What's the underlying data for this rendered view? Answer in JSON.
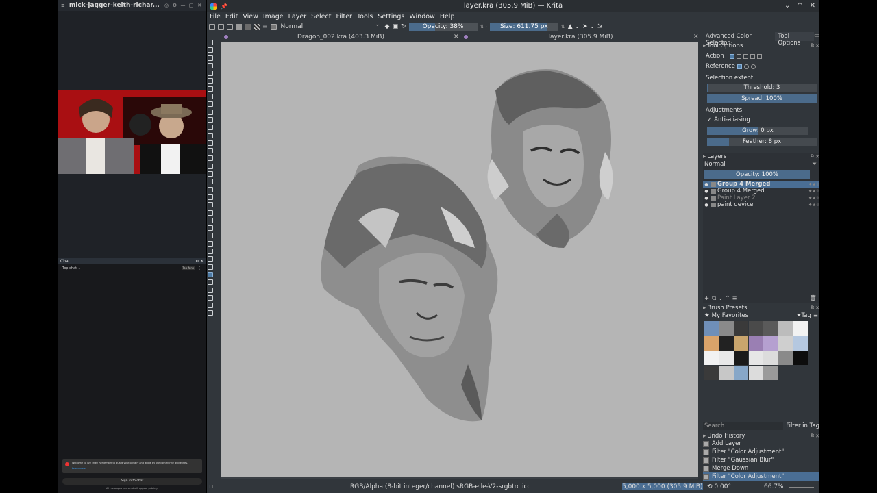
{
  "left_panel": {
    "video_title": "mick-jagger-keith-richar...",
    "chat_header": "Chat",
    "chat_mode": "Top chat",
    "top_fans_label": "Top fans",
    "welcome_text": "Welcome to live chat! Remember to guard your privacy and abide by our community guidelines.",
    "learn_more": "Learn more",
    "sign_in": "Sign in to chat",
    "footer_note": "All messages you send will appear publicly"
  },
  "window": {
    "title": "layer.kra (305.9 MiB) — Krita",
    "min": "⌄",
    "max": "^",
    "close": "✕"
  },
  "menu": [
    "File",
    "Edit",
    "View",
    "Image",
    "Layer",
    "Select",
    "Filter",
    "Tools",
    "Settings",
    "Window",
    "Help"
  ],
  "toolbar": {
    "blend_mode": "Normal",
    "opacity": "Opacity: 38%",
    "opacity_level": 0.38,
    "size": "Size: 611.75 px"
  },
  "documents": [
    {
      "name": "Dragon_002.kra (403.3 MiB)",
      "active": false
    },
    {
      "name": "layer.kra (305.9 MiB)",
      "active": true
    }
  ],
  "dock_tabs": [
    "Advanced Color Selector",
    "Tool Options"
  ],
  "tool_options": {
    "header": "Tool Options",
    "action_label": "Action",
    "reference_label": "Reference",
    "selection_extent": "Selection extent",
    "threshold": "Threshold: 3",
    "spread": "Spread: 100%",
    "spread_level": 1.0,
    "adjustments": "Adjustments",
    "anti_aliasing": "Anti-aliasing",
    "grow": "Grow: 0 px",
    "feather": "Feather: 8 px"
  },
  "layers": {
    "header": "Layers",
    "blend_mode": "Normal",
    "opacity": "Opacity:  100%",
    "items": [
      {
        "name": "Group 4 Merged",
        "selected": true,
        "dimmed": false
      },
      {
        "name": "Group 4 Merged",
        "selected": false,
        "dimmed": false
      },
      {
        "name": "Paint Layer 2",
        "selected": false,
        "dimmed": true
      },
      {
        "name": "paint device",
        "selected": false,
        "dimmed": false
      }
    ]
  },
  "brush_presets": {
    "header": "Brush Presets",
    "favorites": "My Favorites",
    "tag": "Tag",
    "search_placeholder": "Search",
    "filter_in_tag": "Filter in Tag"
  },
  "undo_history": {
    "header": "Undo History",
    "items": [
      "Add Layer",
      "Filter \"Color Adjustment\"",
      "Filter \"Gaussian Blur\"",
      "Merge Down",
      "Filter \"Color Adjustment\""
    ],
    "selected_index": 4
  },
  "status": {
    "color_profile": "RGB/Alpha (8-bit integer/channel)  sRGB-elle-V2-srgbtrc.icc",
    "dimensions": "5,000 x 5,000 (305.9 MiB)",
    "rotation": "0.00°",
    "zoom": "66.7%"
  },
  "colors": {
    "accent": "#4b6b8b",
    "window_bg": "#31363b",
    "canvas_bg": "#b5b5b5"
  }
}
